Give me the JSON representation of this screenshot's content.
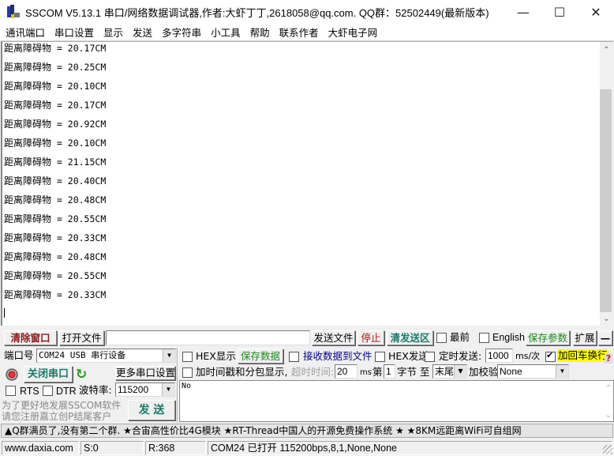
{
  "window": {
    "title": "SSCOM V5.13.1 串口/网络数据调试器,作者:大虾丁丁,2618058@qq.com. QQ群：52502449(最新版本)",
    "minimize_icon": "—",
    "maximize_icon": "☐",
    "close_icon": "✕"
  },
  "menu": [
    {
      "label": "通讯端口"
    },
    {
      "label": "串口设置"
    },
    {
      "label": "显示"
    },
    {
      "label": "发送"
    },
    {
      "label": "多字符串"
    },
    {
      "label": "小工具"
    },
    {
      "label": "帮助"
    },
    {
      "label": "联系作者"
    },
    {
      "label": "大虾电子网"
    }
  ],
  "receive": {
    "lines": [
      {
        "label": "距离障碍物",
        "value": " = 20.17CM"
      },
      {
        "label": "距离障碍物",
        "value": " = 20.25CM"
      },
      {
        "label": "距离障碍物",
        "value": " = 20.10CM"
      },
      {
        "label": "距离障碍物",
        "value": " = 20.17CM"
      },
      {
        "label": "距离障碍物",
        "value": " = 20.92CM"
      },
      {
        "label": "距离障碍物",
        "value": " = 20.10CM"
      },
      {
        "label": "距离障碍物",
        "value": " = 21.15CM"
      },
      {
        "label": "距离障碍物",
        "value": " = 20.40CM"
      },
      {
        "label": "距离障碍物",
        "value": " = 20.48CM"
      },
      {
        "label": "距离障碍物",
        "value": " = 20.55CM"
      },
      {
        "label": "距离障碍物",
        "value": " = 20.33CM"
      },
      {
        "label": "距离障碍物",
        "value": " = 20.48CM"
      },
      {
        "label": "距离障碍物",
        "value": " = 20.55CM"
      },
      {
        "label": "距离障碍物",
        "value": " = 20.33CM"
      }
    ],
    "scroll_up_icon": "⌃",
    "scroll_down_icon": "⌄"
  },
  "toolbar": {
    "clear_window": "清除窗口",
    "open_file": "打开文件",
    "file_path": "",
    "send_file": "发送文件",
    "stop": "停止",
    "clear_send": "清发送区",
    "topmost": {
      "label": "最前",
      "checked": false
    },
    "english": {
      "label": "English",
      "checked": false
    },
    "save_params": "保存参数",
    "expand": "扩展",
    "collapse": "—"
  },
  "port": {
    "port_label": "端口号",
    "port_value": "COM24 USB 串行设备",
    "close_port": "关闭串口",
    "more_settings": "更多串口设置",
    "rts": {
      "label": "RTS",
      "checked": false
    },
    "dtr": {
      "label": "DTR",
      "checked": false
    },
    "baud_label": "波特率:",
    "baud_value": "115200",
    "promo_line1": "为了更好地发展SSCOM软件",
    "promo_line2": "请您注册嘉立创P结尾客户",
    "send_button": "发 送"
  },
  "options": {
    "hex_display": {
      "label": "HEX显示",
      "checked": false
    },
    "save_data": "保存数据",
    "recv_to_file": {
      "label": "接收数据到文件",
      "checked": false
    },
    "hex_send": {
      "label": "HEX发送",
      "checked": false
    },
    "timed_send": {
      "label": "定时发送:",
      "checked": false
    },
    "interval_value": "1000",
    "interval_unit": "ms/次",
    "add_crlf": {
      "label": "加回车换行",
      "checked": true
    },
    "help_icon": "?",
    "timestamp": {
      "label": "加时间戳和分包显示,",
      "checked": false
    },
    "timeout_label": "超时时间:",
    "timeout_value": "20",
    "timeout_unit": "ms",
    "byte_from_label": "第",
    "byte_from_value": "1",
    "byte_unit": "字节 至",
    "byte_to_value": "末尾",
    "checksum_label": "加校验",
    "checksum_value": "None"
  },
  "send": {
    "text": "No"
  },
  "ads": "▲Q群满员了,没有第二个群. ★合宙高性价比4G模块 ★RT-Thread中国人的开源免费操作系统 ★ ★8KM远距离WiFi可自组网",
  "status": {
    "website": "www.daxia.com",
    "sent": "S:0",
    "received": "R:368",
    "port_status": "COM24 已打开  115200bps,8,1,None,None"
  },
  "colors": {
    "clear_window": "#8b1a1a",
    "accent_teal": "#1a7a6a",
    "green_text": "#1a8a1a",
    "stop_red": "#b01010",
    "link_blue": "#00008b",
    "crlf_highlight": "#ffff00"
  }
}
